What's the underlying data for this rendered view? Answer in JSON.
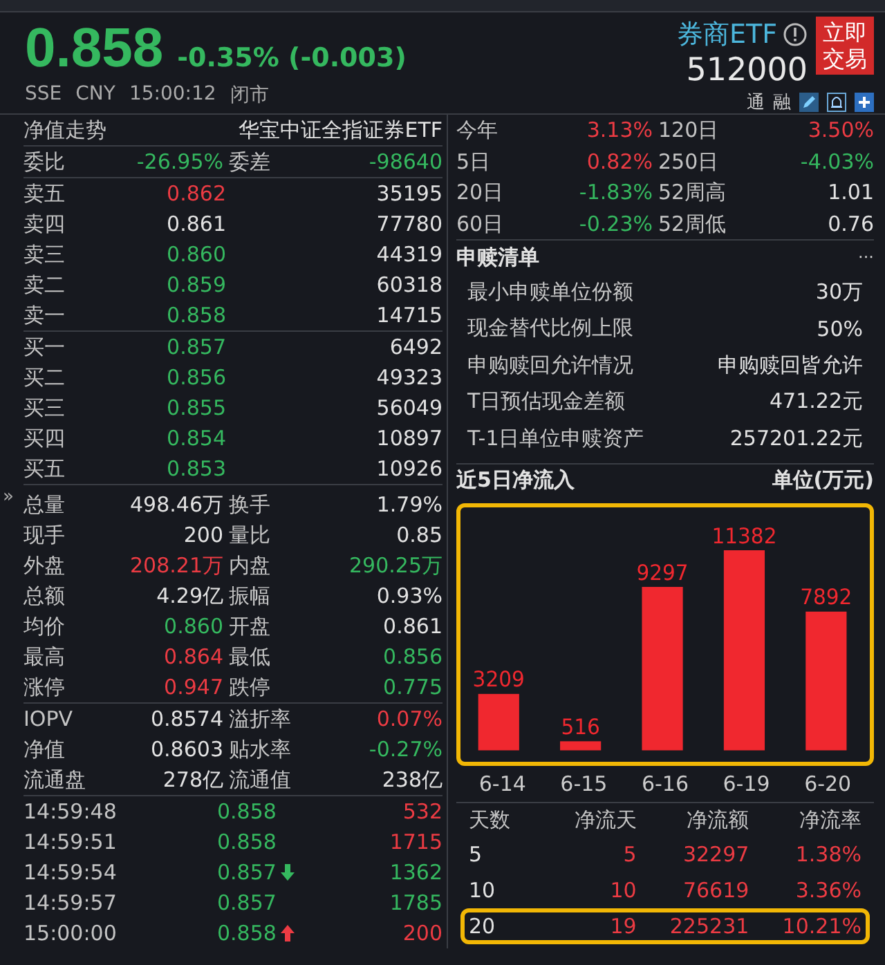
{
  "quote": {
    "price": "0.858",
    "color": "#35b85f",
    "change": "-0.35% (-0.003)",
    "exchange": "SSE",
    "currency": "CNY",
    "time": "15:00:12",
    "status": "闭市",
    "name": "券商ETF",
    "code": "512000",
    "trade_button": "立即交易",
    "badges": [
      "通",
      "融"
    ]
  },
  "side_handle": "»",
  "left_panel": {
    "title": "净值走势",
    "fund_name": "华宝中证全指证券ETF",
    "ratio": [
      {
        "label": "委比",
        "value": "-26.95%",
        "color": "#35b85f"
      },
      {
        "label": "委差",
        "value": "-98640",
        "color": "#35b85f"
      }
    ],
    "asks": [
      {
        "label": "卖五",
        "price": "0.862",
        "color": "#ec3b43",
        "volume": "35195"
      },
      {
        "label": "卖四",
        "price": "0.861",
        "color": "#e2e2e2",
        "volume": "77780"
      },
      {
        "label": "卖三",
        "price": "0.860",
        "color": "#35b85f",
        "volume": "44319"
      },
      {
        "label": "卖二",
        "price": "0.859",
        "color": "#35b85f",
        "volume": "60318"
      },
      {
        "label": "卖一",
        "price": "0.858",
        "color": "#35b85f",
        "volume": "14715"
      }
    ],
    "bids": [
      {
        "label": "买一",
        "price": "0.857",
        "color": "#35b85f",
        "volume": "6492"
      },
      {
        "label": "买二",
        "price": "0.856",
        "color": "#35b85f",
        "volume": "49323"
      },
      {
        "label": "买三",
        "price": "0.855",
        "color": "#35b85f",
        "volume": "56049"
      },
      {
        "label": "买四",
        "price": "0.854",
        "color": "#35b85f",
        "volume": "10897"
      },
      {
        "label": "买五",
        "price": "0.853",
        "color": "#35b85f",
        "volume": "10926"
      }
    ],
    "stats": [
      {
        "label": "总量",
        "value": "498.46万",
        "color": "#e2e2e2"
      },
      {
        "label": "换手",
        "value": "1.79%",
        "color": "#e2e2e2"
      },
      {
        "label": "现手",
        "value": "200",
        "color": "#e2e2e2"
      },
      {
        "label": "量比",
        "value": "0.85",
        "color": "#e2e2e2"
      },
      {
        "label": "外盘",
        "value": "208.21万",
        "color": "#ec3b43"
      },
      {
        "label": "内盘",
        "value": "290.25万",
        "color": "#35b85f"
      },
      {
        "label": "总额",
        "value": "4.29亿",
        "color": "#e2e2e2"
      },
      {
        "label": "振幅",
        "value": "0.93%",
        "color": "#e2e2e2"
      },
      {
        "label": "均价",
        "value": "0.860",
        "color": "#35b85f"
      },
      {
        "label": "开盘",
        "value": "0.861",
        "color": "#e2e2e2"
      },
      {
        "label": "最高",
        "value": "0.864",
        "color": "#ec3b43"
      },
      {
        "label": "最低",
        "value": "0.856",
        "color": "#35b85f"
      },
      {
        "label": "涨停",
        "value": "0.947",
        "color": "#ec3b43"
      },
      {
        "label": "跌停",
        "value": "0.775",
        "color": "#35b85f"
      }
    ],
    "nav_stats": [
      {
        "label": "IOPV",
        "value": "0.8574",
        "color": "#e2e2e2"
      },
      {
        "label": "溢折率",
        "value": "0.07%",
        "color": "#ec3b43"
      },
      {
        "label": "净值",
        "value": "0.8603",
        "color": "#e2e2e2"
      },
      {
        "label": "贴水率",
        "value": "-0.27%",
        "color": "#35b85f"
      },
      {
        "label": "流通盘",
        "value": "278亿",
        "color": "#e2e2e2"
      },
      {
        "label": "流通值",
        "value": "238亿",
        "color": "#e2e2e2"
      }
    ],
    "ticks": [
      {
        "time": "14:59:48",
        "price": "0.858",
        "color": "#35b85f",
        "down_arrow": false,
        "up_arrow": false,
        "volume": {
          "value": "532",
          "color": "#ec3b43"
        }
      },
      {
        "time": "14:59:51",
        "price": "0.858",
        "color": "#35b85f",
        "down_arrow": false,
        "up_arrow": false,
        "volume": {
          "value": "1715",
          "color": "#ec3b43"
        }
      },
      {
        "time": "14:59:54",
        "price": "0.857",
        "color": "#35b85f",
        "down_arrow": true,
        "up_arrow": false,
        "volume": {
          "value": "1362",
          "color": "#35b85f"
        }
      },
      {
        "time": "14:59:57",
        "price": "0.857",
        "color": "#35b85f",
        "down_arrow": false,
        "up_arrow": false,
        "volume": {
          "value": "1785",
          "color": "#35b85f"
        }
      },
      {
        "time": "15:00:00",
        "price": "0.858",
        "color": "#35b85f",
        "down_arrow": false,
        "up_arrow": true,
        "volume": {
          "value": "200",
          "color": "#ec3b43"
        }
      }
    ]
  },
  "right_panel": {
    "returns": [
      {
        "label": "今年",
        "value": "3.13%",
        "color": "#ec3b43"
      },
      {
        "label": "120日",
        "value": "3.50%",
        "color": "#ec3b43"
      },
      {
        "label": "5日",
        "value": "0.82%",
        "color": "#ec3b43"
      },
      {
        "label": "250日",
        "value": "-4.03%",
        "color": "#35b85f"
      },
      {
        "label": "20日",
        "value": "-1.83%",
        "color": "#35b85f"
      },
      {
        "label": "52周高",
        "value": "1.01",
        "color": "#e2e2e2"
      },
      {
        "label": "60日",
        "value": "-0.23%",
        "color": "#35b85f"
      },
      {
        "label": "52周低",
        "value": "0.76",
        "color": "#e2e2e2"
      }
    ],
    "creation": {
      "title": "申赎清单",
      "more": "···",
      "items": [
        {
          "label": "最小申赎单位份额",
          "value": "30万"
        },
        {
          "label": "现金替代比例上限",
          "value": "50%"
        },
        {
          "label": "申购赎回允许情况",
          "value": "申购赎回皆允许"
        },
        {
          "label": "T日预估现金差额",
          "value": "471.22元"
        },
        {
          "label": "T-1日单位申赎资产",
          "value": "257201.22元"
        }
      ]
    },
    "net_inflow": {
      "title": "近5日净流入",
      "unit": "单位(万元)",
      "highlighted": true,
      "chart_data": {
        "type": "bar",
        "categories": [
          "6-14",
          "6-15",
          "6-16",
          "6-19",
          "6-20"
        ],
        "series": [
          {
            "color": "#f0282f",
            "values": [
              3209,
              516,
              9297,
              11382,
              7892
            ]
          }
        ],
        "data_labels": true
      }
    },
    "flow_table": {
      "columns": [
        "天数",
        "净流天",
        "净流额",
        "净流率"
      ],
      "rows": [
        {
          "cells": [
            "5",
            "5",
            "32297",
            "1.38%"
          ],
          "color": "#ec3b43",
          "highlighted": false
        },
        {
          "cells": [
            "10",
            "10",
            "76619",
            "3.36%"
          ],
          "color": "#ec3b43",
          "highlighted": false
        },
        {
          "cells": [
            "20",
            "19",
            "225231",
            "10.21%"
          ],
          "color": "#ec3b43",
          "highlighted": true
        }
      ]
    }
  }
}
